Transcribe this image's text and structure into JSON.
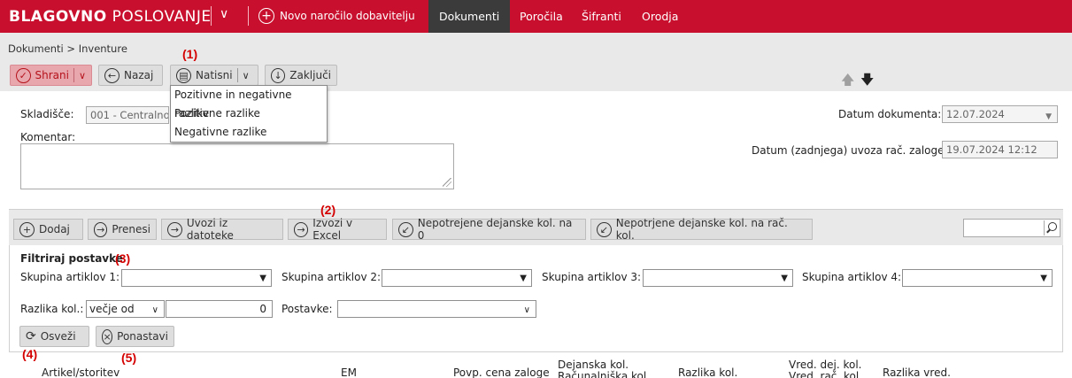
{
  "topbar": {
    "brand_bold": "BLAGOVNO",
    "brand_light": "POSLOVANJE",
    "new_order": "Novo naročilo dobavitelju",
    "nav": [
      "Dokumenti",
      "Poročila",
      "Šifranti",
      "Orodja"
    ],
    "active_nav": "Dokumenti",
    "brand_color": "#c8102e"
  },
  "breadcrumb": "Dokumenti > Inventure",
  "toolbar": {
    "save": "Shrani",
    "back": "Nazaj",
    "print": "Natisni",
    "finish": "Zaključi"
  },
  "print_menu": [
    "Pozitivne in negativne razlike",
    "Pozitivne razlike",
    "Negativne razlike"
  ],
  "markers": {
    "m1": "(1)",
    "m2": "(2)",
    "m3": "(3)",
    "m4": "(4)",
    "m5": "(5)"
  },
  "form": {
    "warehouse_label": "Skladišče:",
    "warehouse_value": "001 - Centralno",
    "comment_label": "Komentar:",
    "doc_date_label": "Datum dokumenta:",
    "doc_date_value": "12.07.2024",
    "import_date_label": "Datum (zadnjega) uvoza rač. zaloge:",
    "import_date_value": "19.07.2024 12:12"
  },
  "actions": {
    "add": "Dodaj",
    "transfer": "Prenesi",
    "import_file": "Uvozi iz datoteke",
    "export_excel": "Izvozi v Excel",
    "unconfirmed_zero": "Nepotrejene dejanske kol. na 0",
    "unconfirmed_calc": "Nepotrjene dejanske kol. na rač. kol."
  },
  "filter": {
    "title": "Filtriraj postavke",
    "group1": "Skupina artiklov 1:",
    "group2": "Skupina artiklov 2:",
    "group3": "Skupina artiklov 3:",
    "group4": "Skupina artiklov 4:",
    "diff_label": "Razlika kol.:",
    "diff_op": "večje od",
    "diff_value": "0",
    "items_label": "Postavke:",
    "refresh": "Osveži",
    "reset": "Ponastavi"
  },
  "columns": {
    "article": "Artikel/storitev",
    "unit": "EM",
    "avg_price": "Povp. cena zaloge",
    "actual_qty_1": "Dejanska kol.",
    "actual_qty_2": "Računalniška kol.",
    "diff_qty": "Razlika kol.",
    "value_1": "Vred. dej. kol.",
    "value_2": "Vred. rač. kol.",
    "diff_value": "Razlika vred."
  }
}
